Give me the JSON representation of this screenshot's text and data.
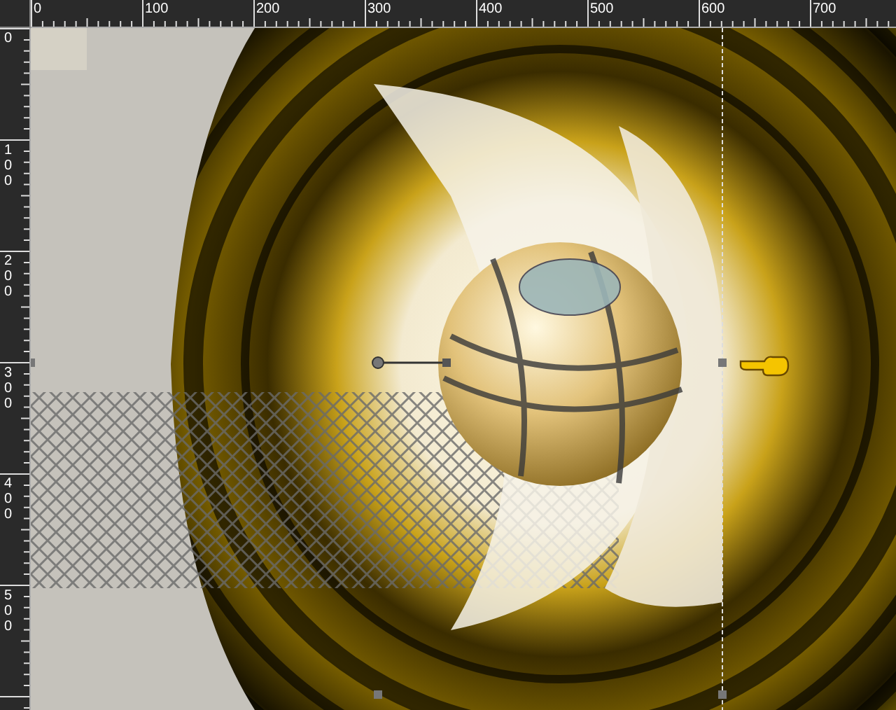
{
  "horizontal_ruler": {
    "labels": [
      "0",
      "100",
      "200",
      "300",
      "400",
      "500",
      "600",
      "700"
    ]
  },
  "vertical_ruler": {
    "labels": [
      "0",
      "100",
      "200",
      "300",
      "400",
      "500"
    ]
  }
}
